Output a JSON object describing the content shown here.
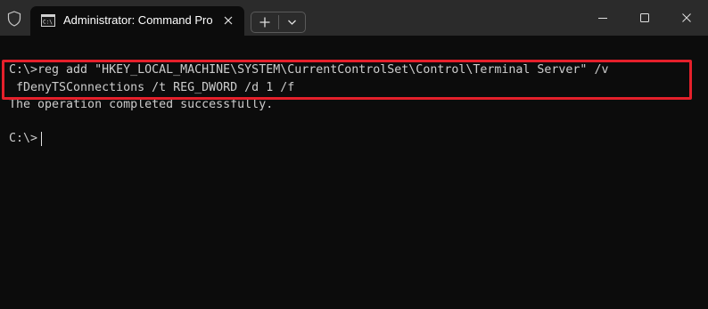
{
  "window": {
    "tab_title": "Administrator: Command Pro",
    "icons": {
      "shield": "shield-icon",
      "tab": "command-prompt-icon",
      "tab_close": "close-icon",
      "new_tab": "plus-icon",
      "dropdown": "chevron-down-icon",
      "minimize": "minimize-icon",
      "maximize": "maximize-icon",
      "close": "close-icon"
    }
  },
  "terminal": {
    "lines": [
      "C:\\>reg add \"HKEY_LOCAL_MACHINE\\SYSTEM\\CurrentControlSet\\Control\\Terminal Server\" /v",
      " fDenyTSConnections /t REG_DWORD /d 1 /f",
      "The operation completed successfully.",
      "C:\\>"
    ]
  },
  "colors": {
    "titlebar": "#2b2b2b",
    "background": "#0c0c0c",
    "text": "#cccccc",
    "highlight": "#e5202b"
  }
}
